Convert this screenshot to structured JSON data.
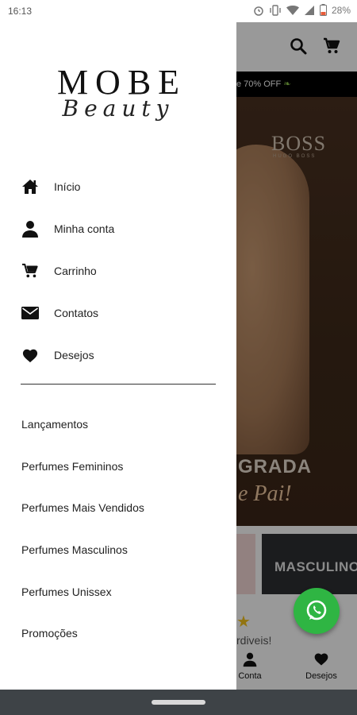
{
  "status_bar": {
    "time": "16:13",
    "battery": "28%",
    "icons": [
      "alarm-icon",
      "vibrate-icon",
      "wifi-icon",
      "signal-icon",
      "battery-icon"
    ]
  },
  "drawer": {
    "logo": {
      "main": "MOBE",
      "script": "Beauty"
    },
    "menu": [
      {
        "icon": "home-icon",
        "label": "Início"
      },
      {
        "icon": "person-icon",
        "label": "Minha conta"
      },
      {
        "icon": "cart-icon",
        "label": "Carrinho"
      },
      {
        "icon": "mail-icon",
        "label": "Contatos"
      },
      {
        "icon": "heart-icon",
        "label": "Desejos"
      }
    ],
    "categories": [
      "Lançamentos",
      "Perfumes Femininos",
      "Perfumes Mais Vendidos",
      "Perfumes Masculinos",
      "Perfumes Unissex",
      "Promoções"
    ]
  },
  "background_app": {
    "promo_text": "e 70% OFF",
    "hero": {
      "brand": "BOSS",
      "brand_sub": "HUGO BOSS",
      "tagline_1": "GRADA",
      "tagline_2": "e Pai!"
    },
    "category_card": "MASCULINO",
    "section_text": "rdiveis!",
    "bottom_nav": [
      {
        "icon": "person-icon",
        "label": "Conta"
      },
      {
        "icon": "heart-icon",
        "label": "Desejos"
      }
    ]
  },
  "colors": {
    "whatsapp": "#2fb543",
    "scrim": "rgba(0,0,0,0.40)",
    "nav_bar": "#3e4347"
  }
}
